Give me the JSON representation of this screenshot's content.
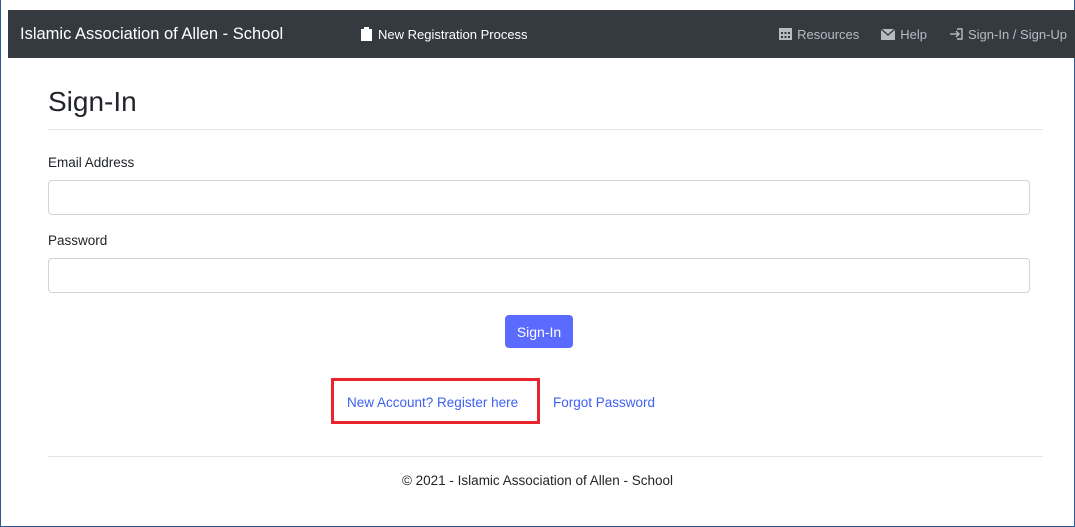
{
  "navbar": {
    "brand": "Islamic Association of Allen - School",
    "new_registration": {
      "label": "New Registration Process",
      "icon": "clipboard-icon"
    },
    "resources": {
      "label": "Resources",
      "icon": "calendar-icon"
    },
    "help": {
      "label": "Help",
      "icon": "envelope-icon"
    },
    "signin_signup": {
      "label": "Sign-In / Sign-Up",
      "icon": "sign-in-icon"
    }
  },
  "page": {
    "title": "Sign-In"
  },
  "form": {
    "email_label": "Email Address",
    "email_value": "",
    "password_label": "Password",
    "password_value": "",
    "submit_label": "Sign-In"
  },
  "links": {
    "register": "New Account? Register here",
    "forgot": "Forgot Password"
  },
  "footer": {
    "text": "© 2021 - Islamic Association of Allen - School"
  },
  "colors": {
    "navbar_bg": "#343a40",
    "primary_button": "#5b6bff",
    "link": "#3e5ff0",
    "highlight_box": "#e8232a"
  }
}
